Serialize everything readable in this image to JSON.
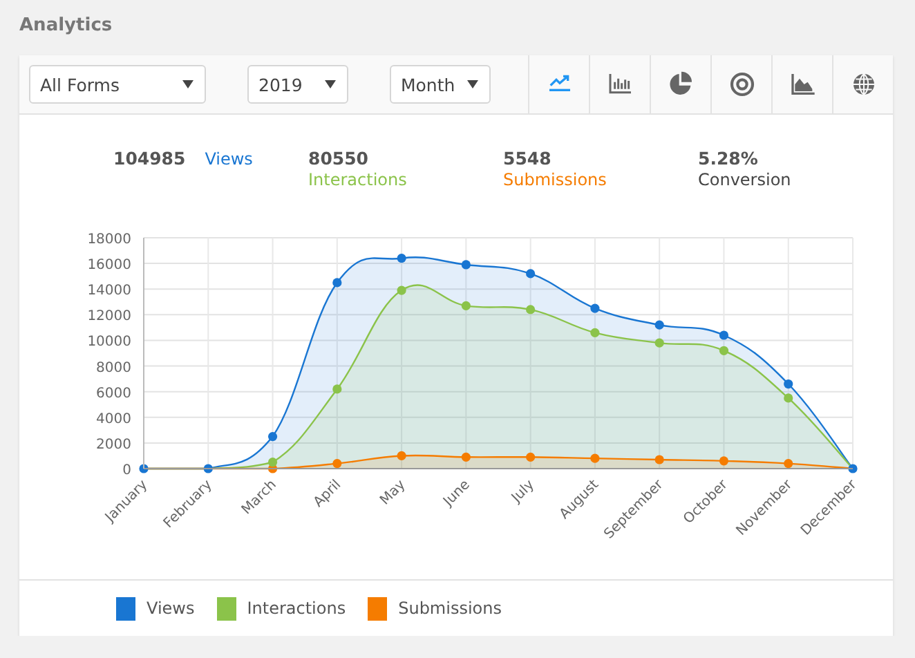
{
  "page_title": "Analytics",
  "filters": [
    {
      "value": "All Forms",
      "kind": "wide"
    },
    {
      "value": "2019",
      "kind": "narrow"
    },
    {
      "value": "Month",
      "kind": "narrow"
    }
  ],
  "chart_types": [
    {
      "kind": "line",
      "selected": true
    },
    {
      "kind": "bar",
      "selected": false
    },
    {
      "kind": "pie",
      "selected": false
    },
    {
      "kind": "donut",
      "selected": false
    },
    {
      "kind": "area",
      "selected": false
    },
    {
      "kind": "globe",
      "selected": false
    }
  ],
  "stats": [
    {
      "value": "104985",
      "label": "Views",
      "color": "#1976d2"
    },
    {
      "value": "80550",
      "label": "Interactions",
      "color": "#8bc34a"
    },
    {
      "value": "5548",
      "label": "Submissions",
      "color": "#f57c00"
    },
    {
      "value": "5.28%",
      "label": "Conversion",
      "color": "#444444"
    }
  ],
  "chart_data": {
    "type": "area",
    "grid": true,
    "categories": [
      "January",
      "February",
      "March",
      "April",
      "May",
      "June",
      "July",
      "August",
      "September",
      "October",
      "November",
      "December"
    ],
    "ylim": [
      0,
      18000
    ],
    "yticks": [
      0,
      2000,
      4000,
      6000,
      8000,
      10000,
      12000,
      14000,
      16000,
      18000
    ],
    "series": [
      {
        "name": "Views",
        "color": "#1976d2",
        "values": [
          0,
          0,
          2500,
          14500,
          16400,
          15900,
          15200,
          12500,
          11200,
          10400,
          6600,
          0
        ]
      },
      {
        "name": "Interactions",
        "color": "#8bc34a",
        "values": [
          0,
          0,
          500,
          6200,
          13900,
          12700,
          12400,
          10600,
          9800,
          9200,
          5500,
          0
        ]
      },
      {
        "name": "Submissions",
        "color": "#f57c00",
        "values": [
          0,
          0,
          0,
          400,
          1000,
          900,
          900,
          800,
          700,
          600,
          400,
          0
        ]
      }
    ]
  }
}
